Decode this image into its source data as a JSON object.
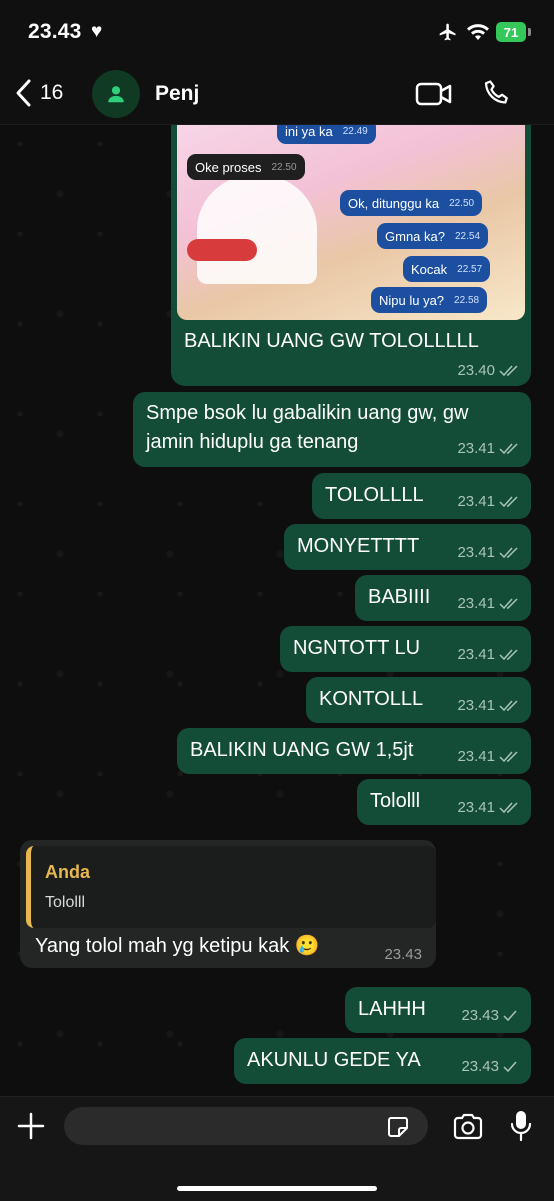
{
  "status": {
    "time": "23.43",
    "battery": "71"
  },
  "header": {
    "back_count": "16",
    "contact_name": "Penj"
  },
  "image_message": {
    "mini_messages": [
      {
        "text": "ini ya ka",
        "time": "22.49"
      },
      {
        "text": "Oke proses",
        "time": "22.50"
      },
      {
        "text": "Ok, ditunggu ka",
        "time": "22.50"
      },
      {
        "text": "Gmna ka?",
        "time": "22.54"
      },
      {
        "text": "Kocak",
        "time": "22.57"
      },
      {
        "text": "Nipu lu ya?",
        "time": "22.58"
      }
    ],
    "caption": "BALIKIN UANG GW TOLOLLLLL",
    "time": "23.40"
  },
  "messages": [
    {
      "line1": "Smpe bsok lu gabalikin uang gw, gw",
      "line2": "jamin hiduplu ga tenang",
      "time": "23.41"
    },
    {
      "text": "TOLOLLLL",
      "time": "23.41"
    },
    {
      "text": "MONYETTTT",
      "time": "23.41"
    },
    {
      "text": "BABIIII",
      "time": "23.41"
    },
    {
      "text": "NGNTOTT LU",
      "time": "23.41"
    },
    {
      "text": "KONTOLLL",
      "time": "23.41"
    },
    {
      "text": "BALIKIN UANG GW 1,5jt",
      "time": "23.41"
    },
    {
      "text": "Tololll",
      "time": "23.41"
    }
  ],
  "reply": {
    "quote_author": "Anda",
    "quote_text": "Tololll",
    "text": "Yang tolol mah yg ketipu kak 🥲",
    "time": "23.43"
  },
  "after": [
    {
      "text": "LAHHH",
      "time": "23.43"
    },
    {
      "text": "AKUNLU GEDE YA",
      "time": "23.43"
    }
  ],
  "colors": {
    "outgoing": "#144d37",
    "incoming": "#242626",
    "quote_accent": "#e6b84f"
  }
}
